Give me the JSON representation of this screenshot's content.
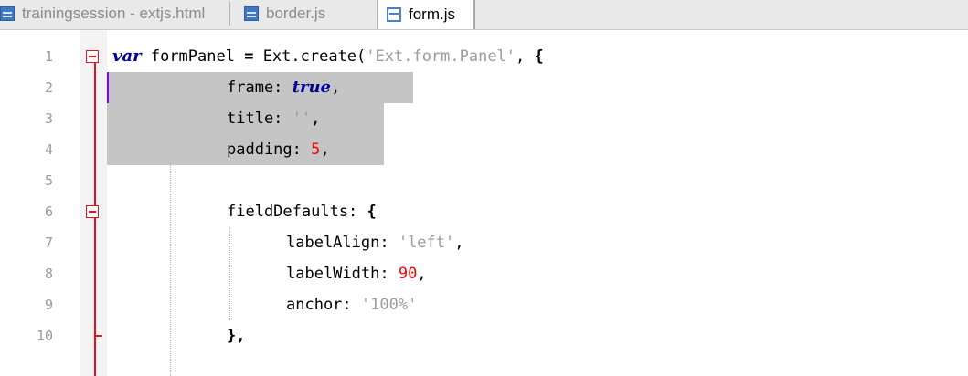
{
  "tabs": [
    {
      "label": "trainingsession - extjs.html",
      "icon": "blue-file-icon",
      "active": false
    },
    {
      "label": "border.js",
      "icon": "blue-file-icon",
      "active": false
    },
    {
      "label": "form.js",
      "icon": "file-icon",
      "active": true
    }
  ],
  "editor": {
    "line_numbers": [
      "1",
      "2",
      "3",
      "4",
      "5",
      "6",
      "7",
      "8",
      "9",
      "10"
    ],
    "code": {
      "l1_var": "var",
      "l1_a": " formPanel ",
      "l1_eq": "=",
      "l1_b": " Ext.create(",
      "l1_str": "'Ext.form.Panel'",
      "l1_c": ", ",
      "l1_brace": "{",
      "l2_key": "frame: ",
      "l2_val": "true",
      "l2_end": ",",
      "l3_key": "title: ",
      "l3_val": "''",
      "l3_end": ",",
      "l4_key": "padding: ",
      "l4_val": "5",
      "l4_end": ",",
      "l6_key": "fieldDefaults: ",
      "l6_brace": "{",
      "l7_key": "labelAlign: ",
      "l7_val": "'left'",
      "l7_end": ",",
      "l8_key": "labelWidth: ",
      "l8_val": "90",
      "l8_end": ",",
      "l9_key": "anchor: ",
      "l9_val": "'100%'",
      "l10": "},"
    },
    "colors": {
      "keyword": "#0000a0",
      "string": "#9c9c9c",
      "number": "#ff0000",
      "fold_marker": "#e8141d",
      "selection": "#c5c5c5",
      "caret": "#8000ff"
    }
  }
}
